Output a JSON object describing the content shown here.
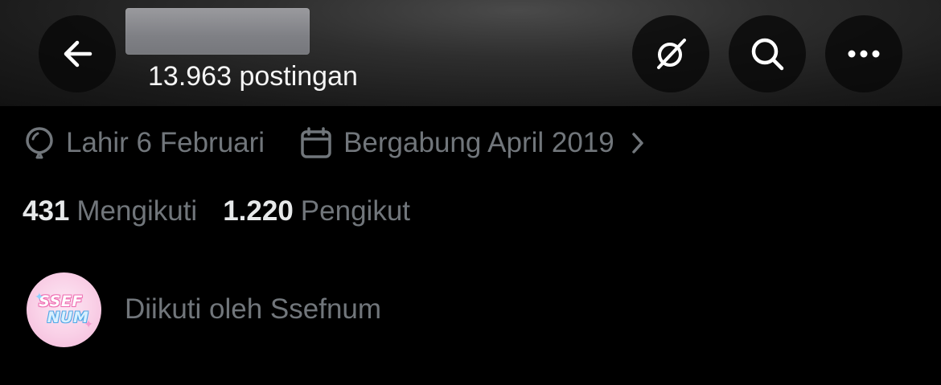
{
  "header": {
    "post_count": "13.963 postingan",
    "icons": {
      "back": "arrow-left-icon",
      "grok": "grok-icon",
      "search": "search-icon",
      "more": "more-horizontal-icon"
    }
  },
  "profile_meta": {
    "birth": "Lahir 6 Februari",
    "joined": "Bergabung April 2019",
    "icons": {
      "birth": "balloon-icon",
      "joined": "calendar-icon",
      "chevron": "chevron-right-icon"
    }
  },
  "stats": {
    "following_count": "431",
    "following_label": "Mengikuti",
    "followers_count": "1.220",
    "followers_label": "Pengikut"
  },
  "followed_by": {
    "text": "Diikuti oleh Ssefnum",
    "avatar_text_line1": "SSEF",
    "avatar_text_line2": "NUM"
  },
  "colors": {
    "background": "#000000",
    "primary_text": "#e7e9ea",
    "secondary_text": "#71767b",
    "button_bg": "#080808"
  }
}
